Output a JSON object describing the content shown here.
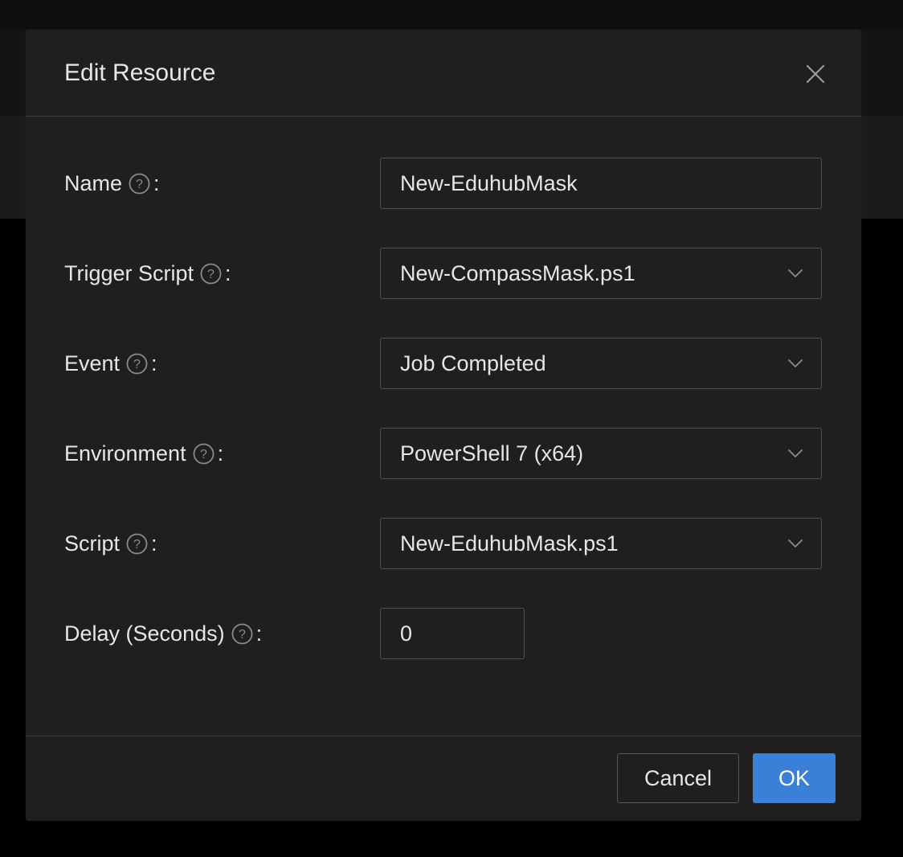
{
  "dialog": {
    "title": "Edit Resource",
    "close_icon": "close-icon"
  },
  "form": {
    "fields": [
      {
        "label": "Name",
        "value": "New-EduhubMask",
        "type": "text"
      },
      {
        "label": "Trigger Script",
        "value": "New-CompassMask.ps1",
        "type": "select"
      },
      {
        "label": "Event",
        "value": "Job Completed",
        "type": "select"
      },
      {
        "label": "Environment",
        "value": "PowerShell 7 (x64)",
        "type": "select"
      },
      {
        "label": "Script",
        "value": "New-EduhubMask.ps1",
        "type": "select"
      },
      {
        "label": "Delay (Seconds)",
        "value": "0",
        "type": "number"
      }
    ],
    "colon": ":",
    "help_icon": "question-circle-icon",
    "dropdown_icon": "chevron-down-icon"
  },
  "footer": {
    "cancel_label": "Cancel",
    "ok_label": "OK"
  },
  "colors": {
    "accent": "#3a7fd8",
    "dialog_bg": "#1f1f1f",
    "text": "#e6e6e6",
    "border": "#505050"
  }
}
